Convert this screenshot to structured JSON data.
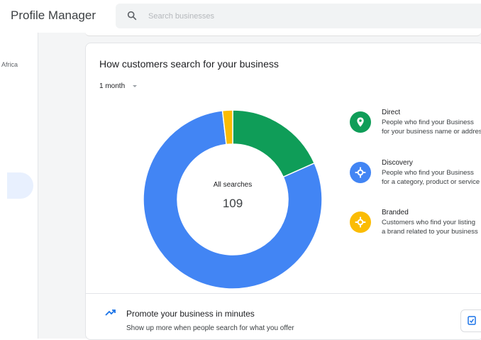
{
  "header": {
    "app_title": "Profile Manager",
    "search_placeholder": "Search businesses",
    "search_icon": "search-icon"
  },
  "sidebar": {
    "country_label": "Africa"
  },
  "card": {
    "title": "How customers search for your business",
    "period": "1 month",
    "total_label": "All searches",
    "total_value": "109",
    "legend": [
      {
        "title": "Direct",
        "line1": "People who find your Business",
        "line2": "for your business name or address",
        "color": "#0f9d58",
        "icon": "location-pin-icon"
      },
      {
        "title": "Discovery",
        "line1": "People who find your Business",
        "line2": "for a category, product or service",
        "color": "#4285f4",
        "icon": "compass-icon"
      },
      {
        "title": "Branded",
        "line1": "Customers who find your listing",
        "line2": "a brand related to your business",
        "color": "#fbbc04",
        "icon": "brand-icon"
      }
    ]
  },
  "chart_data": {
    "type": "pie",
    "title": "How customers search for your business",
    "center_label": "All searches",
    "total": 109,
    "categories": [
      "Direct",
      "Discovery",
      "Branded"
    ],
    "values": [
      20,
      87,
      2
    ],
    "colors": [
      "#0f9d58",
      "#4285f4",
      "#fbbc04"
    ],
    "legend_position": "right"
  },
  "promo": {
    "title": "Promote your business in minutes",
    "subtitle": "Show up more when people search for what you offer",
    "icon": "trending-up-icon"
  }
}
